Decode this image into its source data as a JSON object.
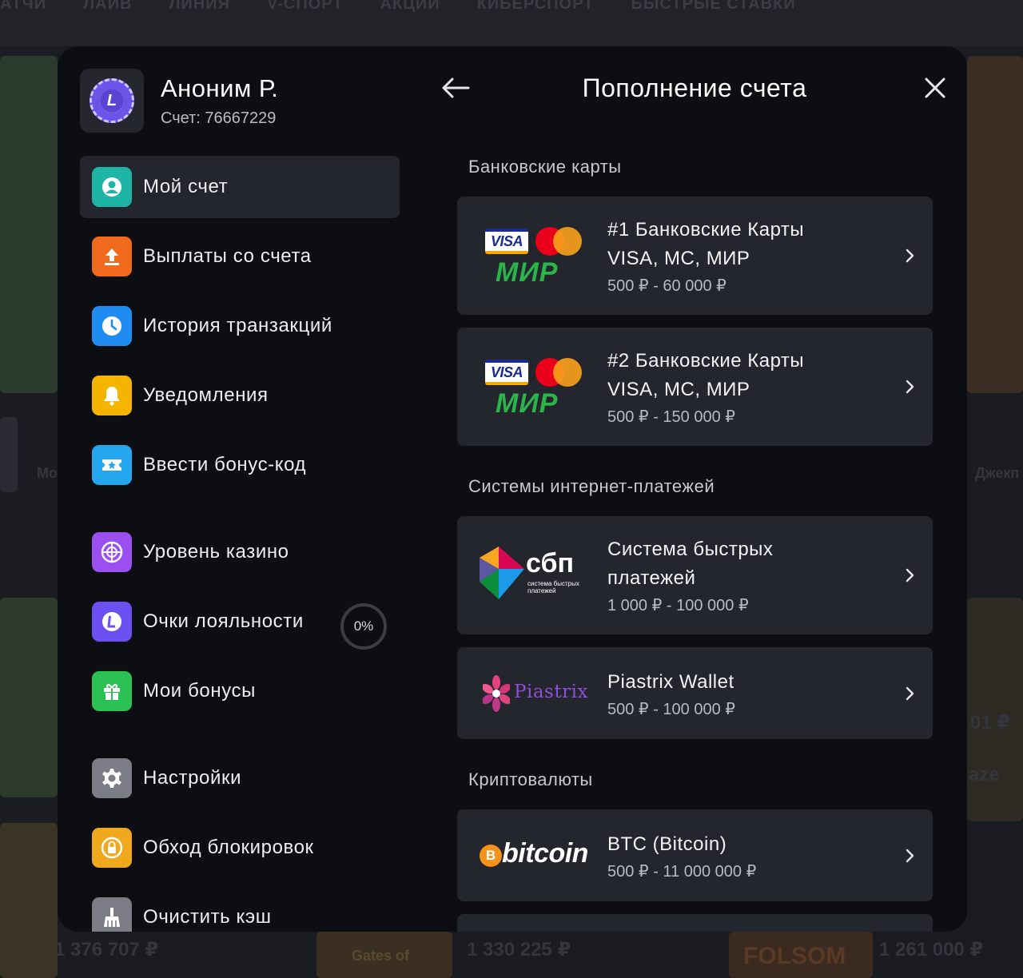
{
  "background": {
    "nav_items": [
      "АТЧИ",
      "ЛАЙВ",
      "ЛИНИЯ",
      "V-СПОРТ",
      "АКЦИИ",
      "КИБЕРСПОРТ",
      "БЫСТРЫЕ СТАВКИ"
    ],
    "faded_texts": {
      "left_label": "Мо",
      "right_label": "Джекп",
      "amount_1": "1 376 707 ₽",
      "amount_2": "1 330 225 ₽",
      "amount_3": "1 261 000 ₽",
      "game_1": "Gates of",
      "game_2": "FOLSOM",
      "side_amount": "01 ₽",
      "side_word": "aze"
    }
  },
  "profile": {
    "name": "Аноним Р.",
    "account": "Счет: 76667229",
    "avatar_letter": "L"
  },
  "menu": {
    "items": [
      {
        "label": "Мой счет",
        "icon": "user-icon",
        "color": "#1fb5a6",
        "active": true
      },
      {
        "label": "Выплаты со счета",
        "icon": "upload-icon",
        "color": "#f06a1d",
        "active": false
      },
      {
        "label": "История транзакций",
        "icon": "clock-icon",
        "color": "#1e8cf0",
        "active": false
      },
      {
        "label": "Уведомления",
        "icon": "bell-icon",
        "color": "#f5b400",
        "active": false
      },
      {
        "label": "Ввести бонус-код",
        "icon": "ticket-icon",
        "color": "#24a7ee",
        "active": false
      },
      {
        "label": "Уровень казино",
        "icon": "roulette-icon",
        "color": "#9b4ff0",
        "active": false
      },
      {
        "label": "Очки лояльности",
        "icon": "loyalty-icon",
        "color": "#6b4ff0",
        "active": false
      },
      {
        "label": "Мои бонусы",
        "icon": "gift-icon",
        "color": "#2cc154",
        "active": false
      },
      {
        "label": "Настройки",
        "icon": "gear-icon",
        "color": "#7b7d86",
        "active": false
      },
      {
        "label": "Обход блокировок",
        "icon": "lock-icon",
        "color": "#f0a81d",
        "active": false
      },
      {
        "label": "Очистить кэш",
        "icon": "broom-icon",
        "color": "#7b7d86",
        "active": false
      }
    ],
    "loyalty_progress": "0%"
  },
  "panel": {
    "title": "Пополнение счета",
    "sections": {
      "bank_cards": "Банковские карты",
      "internet_payments": "Системы интернет-платежей",
      "crypto": "Криптовалюты"
    },
    "methods": [
      {
        "title_line1": "#1 Банковские Карты",
        "title_line2": "VISA, MC, МИР",
        "range": "500 ₽ - 60 000 ₽",
        "logo": "visa-mc-mir-logo"
      },
      {
        "title_line1": "#2 Банковские Карты",
        "title_line2": "VISA, MC, МИР",
        "range": "500 ₽ - 150 000 ₽",
        "logo": "visa-mc-mir-logo"
      },
      {
        "title_line1": "Система быстрых",
        "title_line2": "платежей",
        "range": "1 000 ₽ - 100 000 ₽",
        "logo": "sbp-logo"
      },
      {
        "title_line1": "Piastrix Wallet",
        "range": "500 ₽ - 100 000 ₽",
        "logo": "piastrix-logo"
      },
      {
        "title_line1": "BTC (Bitcoin)",
        "range": "500 ₽ - 11 000 000 ₽",
        "logo": "bitcoin-logo"
      }
    ],
    "logos": {
      "visa": "VISA",
      "mir": "МИР",
      "sbp": "сбп",
      "sbp_sub": "система быстрых платежей",
      "piastrix": "Piastrix",
      "bitcoin": "bitcoin",
      "btc_symbol": "B"
    }
  }
}
